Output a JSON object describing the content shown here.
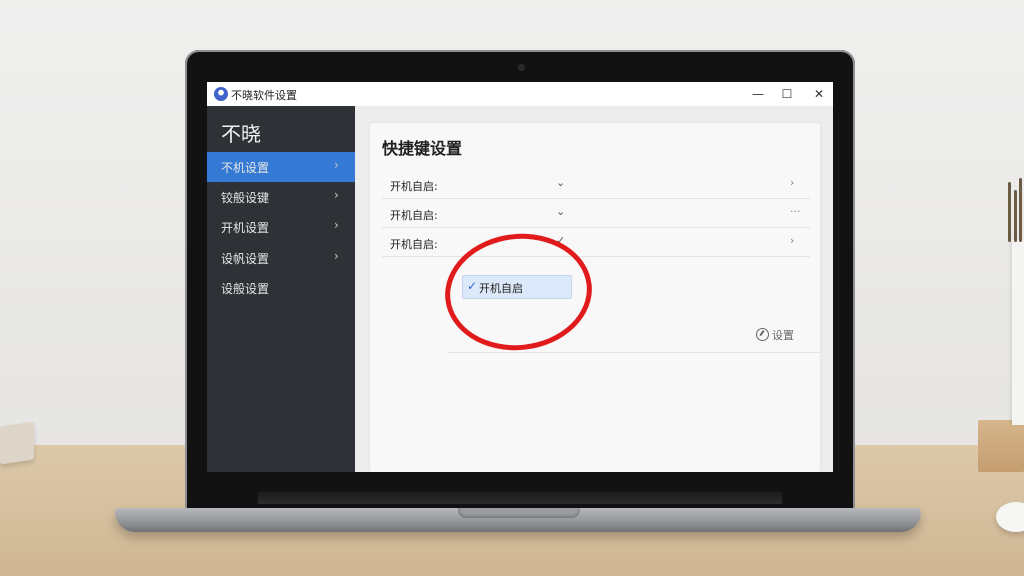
{
  "window": {
    "title": "不晓软件设置",
    "controls": [
      "—",
      "☐",
      "✕"
    ]
  },
  "sidebar": {
    "brand": "不晓",
    "items": [
      {
        "label": "不机设置",
        "chevron": "›",
        "active": true
      },
      {
        "label": "铰般设键",
        "chevron": "›",
        "active": false
      },
      {
        "label": "开机设置",
        "chevron": "›",
        "active": false
      },
      {
        "label": "设帆设置",
        "chevron": "›",
        "active": false
      },
      {
        "label": "设般设置",
        "chevron": "",
        "active": false
      }
    ]
  },
  "main": {
    "section_title": "快捷键设置",
    "rows": [
      {
        "label": "开机自启:",
        "dropdown_icon": "⌄",
        "end_icon": "›"
      },
      {
        "label": "开机自启:",
        "dropdown_icon": "⌄",
        "end_icon": "···"
      },
      {
        "label": "开机自启:",
        "dropdown_icon": "✓",
        "end_icon": "›"
      }
    ],
    "dropdown_option": {
      "check": "✓",
      "label": "开机自启"
    },
    "settings_link": "设置"
  },
  "colors": {
    "sidebar_bg": "#2e3136",
    "active_item": "#3479d4",
    "highlight_ring": "#e11b1b",
    "dropdown_bg": "#dce9fa"
  },
  "icons": [
    "app-icon",
    "chevron-right-icon",
    "chevron-down-icon",
    "check-icon",
    "gear-icon",
    "close-icon"
  ]
}
